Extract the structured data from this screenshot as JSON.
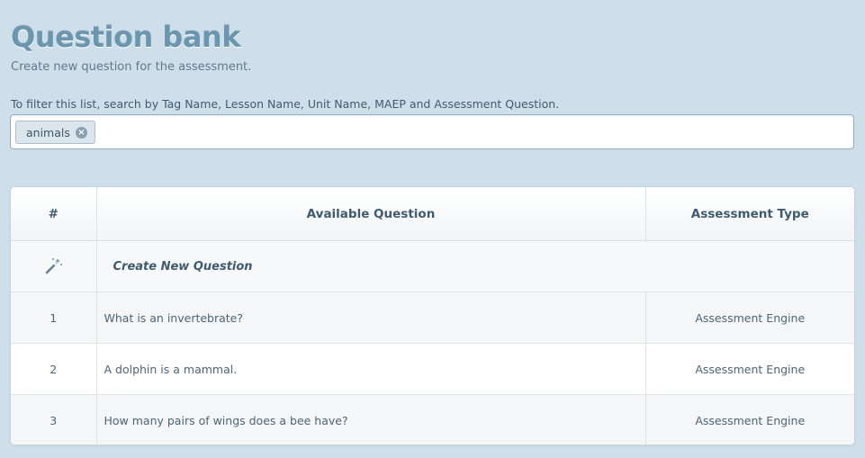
{
  "header": {
    "title": "Question bank",
    "subtitle": "Create new question for the assessment."
  },
  "filter": {
    "hint": "To filter this list, search by Tag Name, Lesson Name, Unit Name, MAEP and Assessment Question.",
    "tags": [
      {
        "label": "animals"
      }
    ],
    "placeholder": ""
  },
  "table": {
    "columns": [
      "#",
      "Available Question",
      "Assessment Type"
    ],
    "create_label": "Create New Question",
    "create_icon": "magic-wand-icon",
    "rows": [
      {
        "num": "1",
        "question": "What is an invertebrate?",
        "type": "Assessment Engine"
      },
      {
        "num": "2",
        "question": "A dolphin is a mammal.",
        "type": "Assessment Engine"
      },
      {
        "num": "3",
        "question": "How many pairs of wings does a bee have?",
        "type": "Assessment Engine"
      }
    ]
  },
  "colors": {
    "background": "#cfdfe9",
    "title": "#6a97ae",
    "text": "#3f5b70"
  }
}
